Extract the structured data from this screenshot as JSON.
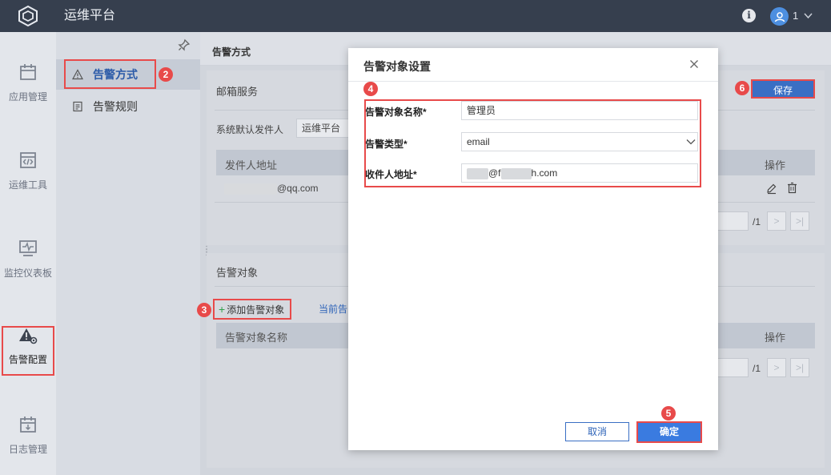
{
  "app": {
    "title": "运维平台",
    "user": "1"
  },
  "leftnav": [
    {
      "label": "应用管理",
      "icon": "calendar-icon"
    },
    {
      "label": "运维工具",
      "icon": "code-window-icon"
    },
    {
      "label": "监控仪表板",
      "icon": "monitor-icon"
    },
    {
      "label": "告警配置",
      "icon": "alert-gear-icon",
      "active": true
    },
    {
      "label": "日志管理",
      "icon": "calendar-download-icon"
    }
  ],
  "subnav": [
    {
      "label": "告警方式",
      "icon": "warning-triangle-icon",
      "active": true
    },
    {
      "label": "告警规则",
      "icon": "document-list-icon"
    }
  ],
  "main": {
    "title": "告警方式",
    "mail": {
      "section": "邮箱服务",
      "sender_label": "系统默认发件人",
      "sender_value": "运维平台",
      "col_sender": "发件人地址",
      "col_ops": "操作",
      "row_email_suffix": "@qq.com",
      "pager_total": "/1"
    },
    "save_label": "保存",
    "target": {
      "section": "告警对象",
      "add_label": "添加告警对象",
      "current_link": "当前告",
      "col_name": "告警对象名称",
      "col_ops": "操作",
      "pager_total": "/1"
    }
  },
  "modal": {
    "title": "告警对象设置",
    "name_label": "告警对象名称*",
    "name_value": "管理员",
    "type_label": "告警类型*",
    "type_value": "email",
    "addr_label": "收件人地址*",
    "addr_part1": "@f",
    "addr_part2": "h.com",
    "cancel_label": "取消",
    "ok_label": "确定"
  },
  "badges": [
    "1",
    "2",
    "3",
    "4",
    "5",
    "6"
  ],
  "colors": {
    "topbar": "#363f4e",
    "accent": "#3a6fc4",
    "annotation": "#e84a4a"
  }
}
